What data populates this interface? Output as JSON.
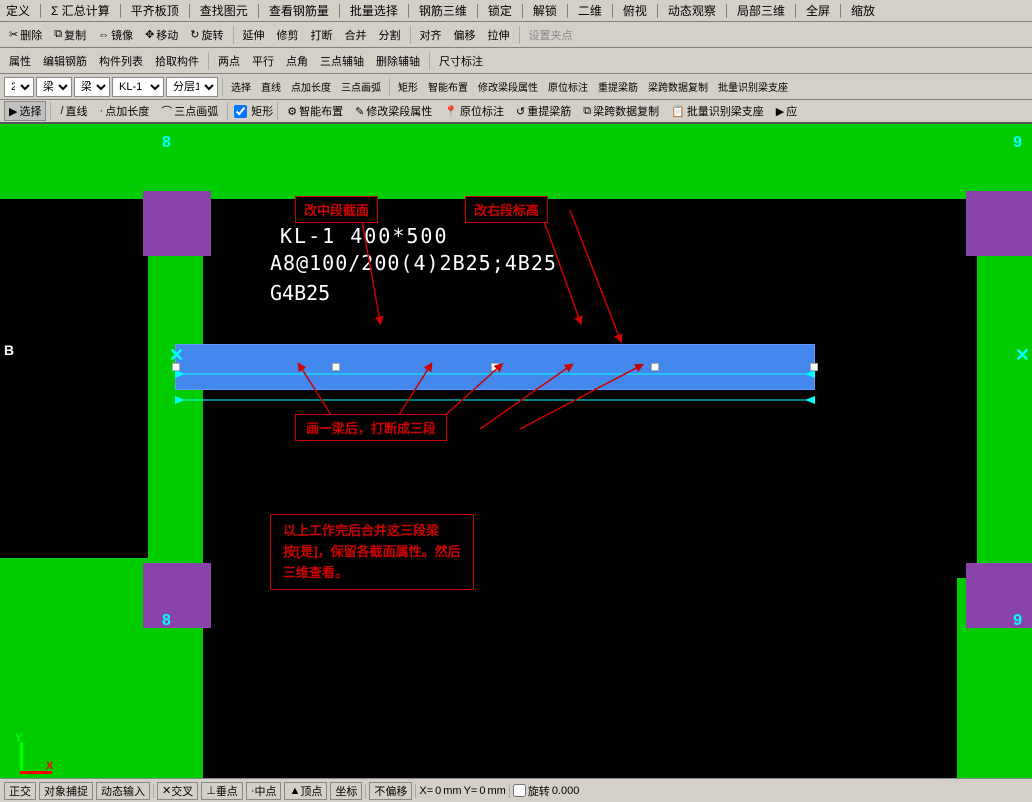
{
  "menubar": {
    "items": [
      "定义",
      "Σ 汇总计算",
      "平齐板顶",
      "查找图元",
      "查看钢筋量",
      "批量选择",
      "钢筋三维",
      "锁定",
      "解锁",
      "二维",
      "俯视",
      "动态观察",
      "局部三维",
      "全屏",
      "缩放"
    ]
  },
  "toolbar1": {
    "items": [
      "删除",
      "复制",
      "镜像",
      "移动",
      "旋转",
      "延伸",
      "修剪",
      "打断",
      "合并",
      "分割",
      "对齐",
      "偏移",
      "拉伸",
      "设置夹点"
    ]
  },
  "toolbar2": {
    "items": [
      "属性",
      "编辑钢筋",
      "构件列表",
      "拾取构件",
      "两点",
      "平行",
      "点角",
      "三点辅轴",
      "删除辅轴",
      "尺寸标注"
    ]
  },
  "toolbar3": {
    "layer_num": "2",
    "type1": "梁",
    "type2": "梁",
    "id": "KL-1",
    "layer": "分层1",
    "items": [
      "选择",
      "直线",
      "点加长度",
      "三点画弧",
      "矩形",
      "智能布置",
      "修改梁段属性",
      "原位标注",
      "重提梁筋",
      "梁跨数据复制",
      "批量识别梁支座",
      "应用"
    ]
  },
  "snapbar": {
    "items": [
      "选择",
      "直线",
      "点加长度",
      "三点画弧",
      "矩形",
      "智能布置",
      "修改梁段属性",
      "原位标注",
      "重提梁筋",
      "梁跨数据复制",
      "批量识别梁支座"
    ]
  },
  "canvas": {
    "beam_label_line1": "KL-1 400*500",
    "beam_label_line2": "A8@100/200(4)2B25;4B25",
    "beam_label_line3": "G4B25",
    "anno_mid_section": "改中段截面",
    "anno_right_elevation": "改右段标高",
    "anno_break": "画一梁后，打断成三段",
    "anno_merge_title": "以上工作完后合并这三段梁",
    "anno_merge_body": "按[是]，保留各截面属性。然后\n三维查看。",
    "num_top_left": "8",
    "num_top_right": "9",
    "num_bottom_left": "8",
    "num_bottom_right": "9",
    "axis_b": "B"
  },
  "statusbar": {
    "ortho": "正交",
    "snap": "对象捕捉",
    "dynamic": "动态输入",
    "cross": "交叉",
    "midpoint": "垂点",
    "center": "中点",
    "top": "顶点",
    "coord": "坐标",
    "not_offset": "不偏移",
    "x_label": "X=",
    "x_value": "0",
    "unit1": "mm",
    "y_label": "Y=",
    "y_value": "0",
    "unit2": "mm",
    "rotate_label": "旋转",
    "rotate_value": "0.000"
  }
}
